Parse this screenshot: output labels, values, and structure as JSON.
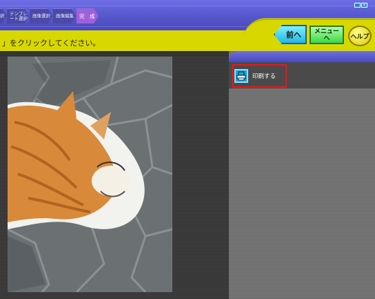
{
  "header": {
    "steps": [
      {
        "label": "択"
      },
      {
        "label": "テンプレート選択"
      },
      {
        "label": "画像選択"
      },
      {
        "label": "画像編集"
      },
      {
        "label": "完　成"
      }
    ],
    "window_buttons": [
      "_",
      "×"
    ]
  },
  "instruction": "」をクリックしてください。",
  "nav": {
    "prev_label": "前へ",
    "menu_label_line1": "メニュー",
    "menu_label_line2": "へ",
    "help_label": "ヘルプ"
  },
  "side": {
    "print_label": "印刷する"
  },
  "colors": {
    "header": "#5656cc",
    "yellow_band": "#d8d800",
    "highlight": "#ff1010",
    "print_icon": "#1aa8d8"
  }
}
